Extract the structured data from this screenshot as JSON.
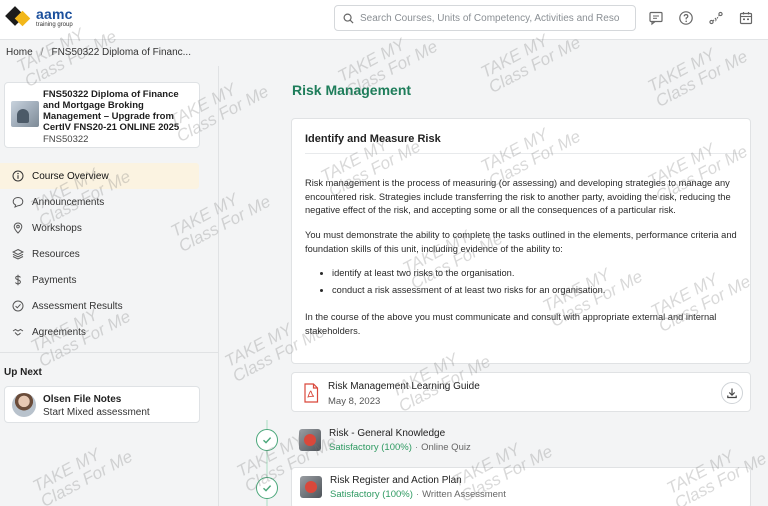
{
  "header": {
    "logo_main": "aamc",
    "logo_sub": "training group",
    "search_placeholder": "Search Courses, Units of Competency, Activities and Reso...",
    "icons": [
      "chat-icon",
      "help-icon",
      "pathway-icon",
      "calendar-icon"
    ]
  },
  "breadcrumb": {
    "home": "Home",
    "separator": "/",
    "current": "FNS50322 Diploma of Financ..."
  },
  "course": {
    "title": "FNS50322 Diploma of Finance and Mortgage Broking Management – Upgrade from CertIV FNS20-21 ONLINE 2025",
    "code": "FNS50322"
  },
  "nav": [
    {
      "label": "Course Overview",
      "icon": "info-icon",
      "active": true
    },
    {
      "label": "Announcements",
      "icon": "speech-bubble-icon",
      "active": false
    },
    {
      "label": "Workshops",
      "icon": "location-pin-icon",
      "active": false
    },
    {
      "label": "Resources",
      "icon": "stack-icon",
      "active": false
    },
    {
      "label": "Payments",
      "icon": "dollar-icon",
      "active": false
    },
    {
      "label": "Assessment Results",
      "icon": "check-circle-icon",
      "active": false
    },
    {
      "label": "Agreements",
      "icon": "handshake-icon",
      "active": false
    }
  ],
  "up_next": {
    "label": "Up Next",
    "title": "Olsen File Notes",
    "subtitle": "Start Mixed assessment"
  },
  "main": {
    "title": "Risk Management",
    "card": {
      "heading": "Identify and Measure Risk",
      "p1": "Risk management is the process of measuring (or assessing) and developing strategies to manage any encountered risk. Strategies include transferring the risk to another party, avoiding the risk, reducing the negative effect of the risk, and accepting some or all the consequences of a particular risk.",
      "p2": "You must demonstrate the ability to complete the tasks outlined in the elements, performance criteria and foundation skills of this unit, including evidence of the ability to:",
      "bullets": [
        "identify at least two risks to the organisation.",
        "conduct a risk assessment of at least two risks for an organisation."
      ],
      "p3": "In the course of the above you must communicate and consult with appropriate external and internal stakeholders."
    },
    "document": {
      "title": "Risk Management Learning Guide",
      "date": "May 8, 2023"
    },
    "assessments": [
      {
        "title": "Risk - General Knowledge",
        "status": "Satisfactory (100%)",
        "separator": "·",
        "kind": "Online Quiz"
      },
      {
        "title": "Risk Register and Action Plan",
        "status": "Satisfactory (100%)",
        "separator": "·",
        "kind": "Written Assessment"
      }
    ]
  },
  "watermark": {
    "line1": "TAKE MY",
    "line2": "Class For Me"
  },
  "colors": {
    "accent_green": "#1e7d5a",
    "status_green": "#2f9a62",
    "brand_blue": "#1a4f9c",
    "brand_yellow": "#f2b71a",
    "active_nav_bg": "#fbf3e1"
  }
}
